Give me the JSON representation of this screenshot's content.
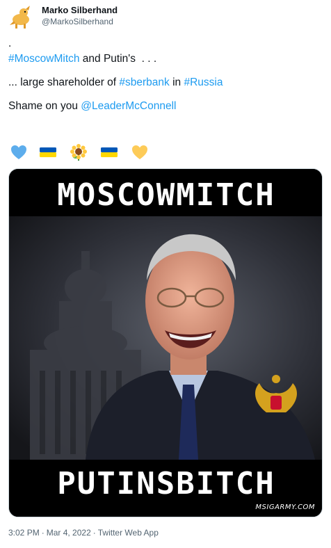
{
  "author": {
    "display_name": "Marko Silberhand",
    "handle": "@MarkoSilberhand"
  },
  "tweet": {
    "line1": ".",
    "line2_tag": "#MoscowMitch",
    "line2_rest": " and Putin's  . . .",
    "line3_pre": "... large shareholder of ",
    "line3_tag1": "#sberbank",
    "line3_mid": " in ",
    "line3_tag2": "#Russia",
    "line4_pre": "Shame on you ",
    "line4_mention": "@LeaderMcConnell",
    "emojis": [
      "blue-heart",
      "ukraine-flag",
      "sunflower",
      "ukraine-flag",
      "yellow-heart"
    ]
  },
  "media": {
    "top_caption": "MOSCOWMITCH",
    "bottom_caption": "PUTINSBITCH",
    "watermark": "MSIGARMY.COM"
  },
  "meta": {
    "time": "3:02 PM",
    "date": "Mar 4, 2022",
    "source": "Twitter Web App",
    "separator": "·"
  },
  "colors": {
    "link": "#1d9bf0",
    "secondary_text": "#536471",
    "flag_blue": "#0057b7",
    "flag_yellow": "#ffd700"
  }
}
